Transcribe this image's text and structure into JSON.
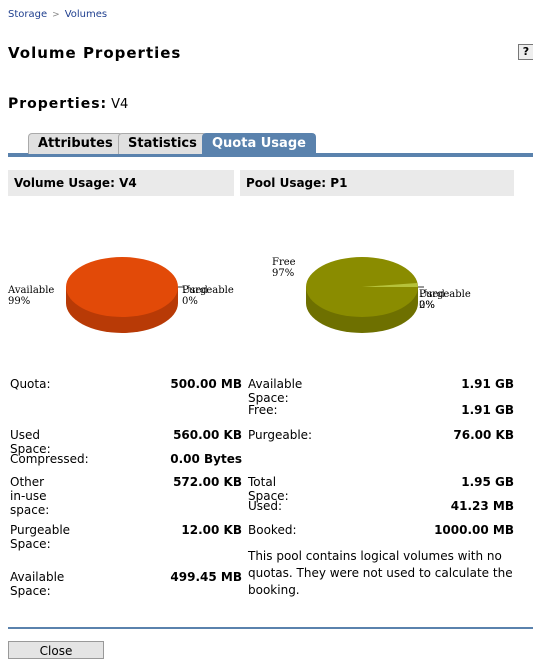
{
  "breadcrumb": {
    "items": [
      "Storage",
      "Volumes"
    ],
    "separator": ">"
  },
  "page_title": "Volume Properties",
  "help_label": "?",
  "properties": {
    "label": "Properties:",
    "value": "V4"
  },
  "tabs": [
    {
      "label": "Attributes",
      "active": false
    },
    {
      "label": "Statistics",
      "active": false
    },
    {
      "label": "Quota Usage",
      "active": true
    }
  ],
  "volume_usage": {
    "header_label": "Volume Usage:",
    "header_value": "V4",
    "chart": {
      "type": "pie",
      "slices": [
        {
          "label": "Available",
          "value": 99,
          "display": "99%",
          "color": "#e24a08"
        },
        {
          "label": "Used",
          "value": 0.5,
          "display": "0%",
          "color": "#c23a06"
        },
        {
          "label": "Purgeable",
          "value": 0.5,
          "display": "0%",
          "color": "#c23a06"
        }
      ]
    },
    "rows": [
      {
        "key": "Quota:",
        "value": "500.00 MB"
      },
      {
        "key": "Used Space:",
        "value": "560.00 KB"
      },
      {
        "key": "Compressed:",
        "value": "0.00 Bytes"
      },
      {
        "key": "Other in-use space:",
        "value": "572.00 KB"
      },
      {
        "key": "Purgeable Space:",
        "value": "12.00 KB"
      },
      {
        "key": "Available Space:",
        "value": "499.45 MB"
      }
    ]
  },
  "pool_usage": {
    "header_label": "Pool Usage:",
    "header_value": "P1",
    "chart": {
      "type": "pie",
      "slices": [
        {
          "label": "Free",
          "value": 97,
          "display": "97%",
          "color": "#8a8c00"
        },
        {
          "label": "Used",
          "value": 2,
          "display": "2%",
          "color": "#b6c23a"
        },
        {
          "label": "Purgeable",
          "value": 1,
          "display": "0%",
          "color": "#b6c23a"
        }
      ]
    },
    "rows": [
      {
        "key": "Available Space:",
        "value": "1.91 GB"
      },
      {
        "key": "Free:",
        "value": "1.91 GB"
      },
      {
        "key": "Purgeable:",
        "value": "76.00 KB"
      },
      {
        "key": "Total Space:",
        "value": "1.95 GB"
      },
      {
        "key": "Used:",
        "value": "41.23 MB"
      },
      {
        "key": "Booked:",
        "value": "1000.00 MB"
      }
    ],
    "note": "This pool contains logical volumes with no quotas. They were not used to calculate the booking."
  },
  "close_label": "Close",
  "colors": {
    "accent": "#5a82ad",
    "link": "#1f3f8f",
    "header_bg": "#eaeaea"
  }
}
